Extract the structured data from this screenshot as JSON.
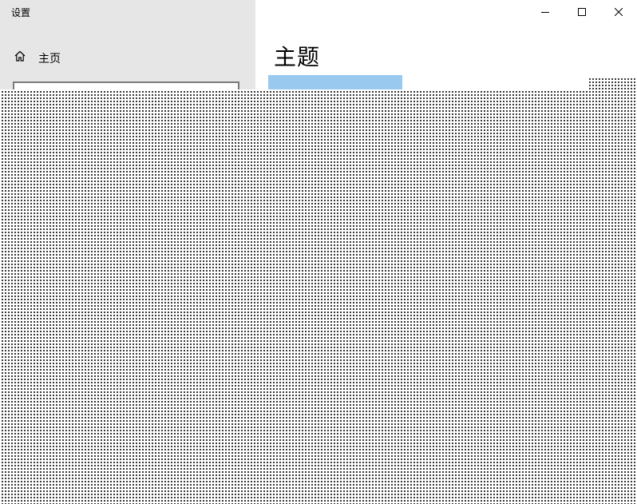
{
  "window": {
    "title": "设置"
  },
  "sidebar": {
    "home_label": "主页",
    "search_placeholder": "",
    "search_value": ""
  },
  "main": {
    "title": "主题"
  },
  "icons": {
    "home": "home-icon",
    "minimize": "minimize-icon",
    "maximize": "maximize-icon",
    "close": "close-icon"
  },
  "colors": {
    "sidebar_bg": "#e6e6e6",
    "theme_preview": "#99c9ee",
    "content_bg": "#ffffff"
  }
}
